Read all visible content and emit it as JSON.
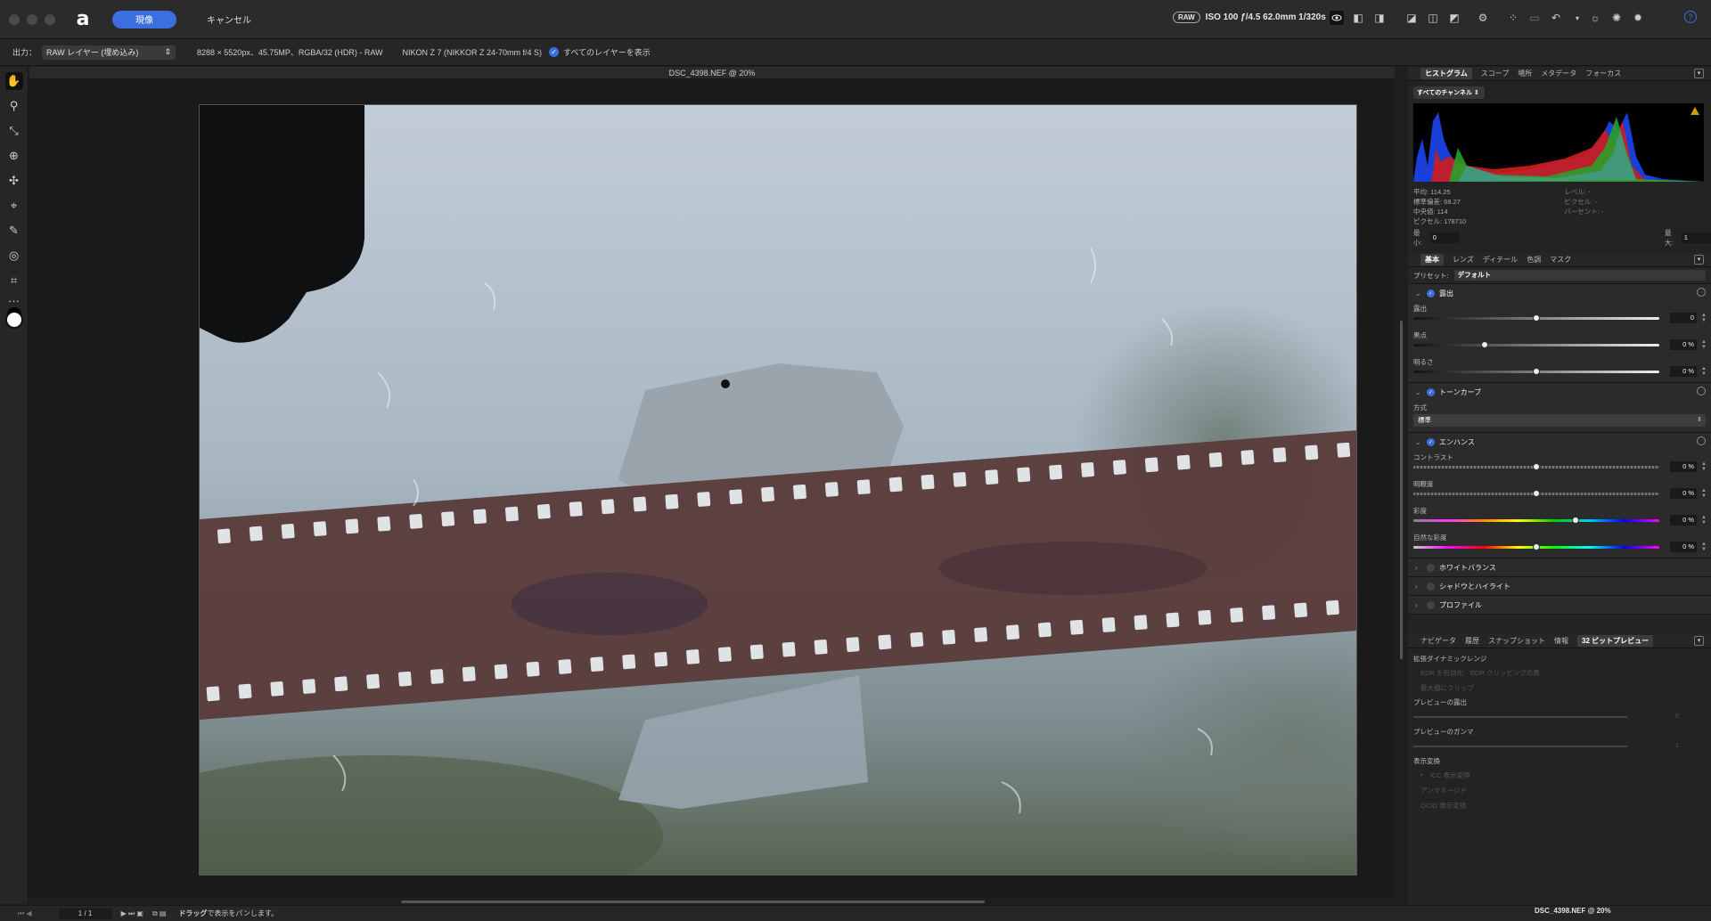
{
  "titlebar": {
    "develop_label": "現像",
    "cancel_label": "キャンセル",
    "raw_badge": "RAW",
    "exif": "ISO 100 ƒ/4.5 62.0mm 1/320s"
  },
  "context": {
    "output_label": "出力：",
    "output_value": "RAW レイヤー (埋め込み)",
    "image_info": "8288 × 5520px、45.75MP、RGBA/32 (HDR) - RAW",
    "camera": "NIKON Z 7 (NIKKOR Z 24-70mm f/4 S)",
    "show_layers": "すべてのレイヤーを表示"
  },
  "document": {
    "title": "DSC_4398.NEF @ 20%"
  },
  "status": {
    "page": "1 / 1",
    "hint_bold": "ドラッグ",
    "hint": "で表示をパンします。",
    "right_title": "DSC_4398.NEF @ 20%"
  },
  "panel_top": {
    "tabs": [
      "ヒストグラム",
      "スコープ",
      "場所",
      "メタデータ",
      "フォーカス"
    ],
    "channel": "すべてのチャンネル ⇕",
    "stats": [
      "平均: 114.25",
      "標準偏差: 68.27",
      "中央値: 114",
      "ピクセル: 178710"
    ],
    "stats2": [
      "レベル: -",
      "ピクセル: -",
      "パーセント: -"
    ],
    "min_label": "最小:",
    "min_value": "0",
    "max_label": "最大:",
    "max_value": "1"
  },
  "panel_mid": {
    "tabs": [
      "基本",
      "レンズ",
      "ディテール",
      "色調",
      "マスク"
    ],
    "preset_label": "プリセット:",
    "preset_value": "デフォルト",
    "exposure": {
      "title": "露出",
      "sliders": [
        {
          "label": "露出",
          "value": "0",
          "pos": 0.5
        },
        {
          "label": "黒点",
          "value": "0 %",
          "pos": 0.29
        },
        {
          "label": "明るさ",
          "value": "0 %",
          "pos": 0.5
        }
      ]
    },
    "tone_curve": {
      "title": "トーンカーブ",
      "method_label": "方式",
      "method_value": "標準"
    },
    "enhance": {
      "title": "エンハンス",
      "sliders": [
        {
          "label": "コントラスト",
          "value": "0 %",
          "pos": 0.5
        },
        {
          "label": "明瞭度",
          "value": "0 %",
          "pos": 0.5
        },
        {
          "label": "彩度",
          "value": "0 %",
          "pos": 0.66
        },
        {
          "label": "自然な彩度",
          "value": "0 %",
          "pos": 0.5
        }
      ]
    },
    "white_balance": "ホワイトバランス",
    "shadows": "シャドウとハイライト",
    "profile": "プロファイル"
  },
  "panel_bottom": {
    "tabs": [
      "ナビゲータ",
      "履歴",
      "スナップショット",
      "情報",
      "32 ビットプレビュー"
    ],
    "edr_title": "拡張ダイナミックレンジ",
    "edr_enable": "EDR を有効化",
    "edr_clip": "EDR クリッピングの表",
    "max_clip": "最大値にクリップ",
    "preview_exposure": "プレビューの露出",
    "preview_exposure_val": "0",
    "preview_gamma": "プレビューのガンマ",
    "preview_gamma_val": "1",
    "display_transform": "表示変換",
    "icc": "ICC 表示変換",
    "unmanaged": "アンマネージド",
    "ocio": "OCIO 表示変換"
  }
}
